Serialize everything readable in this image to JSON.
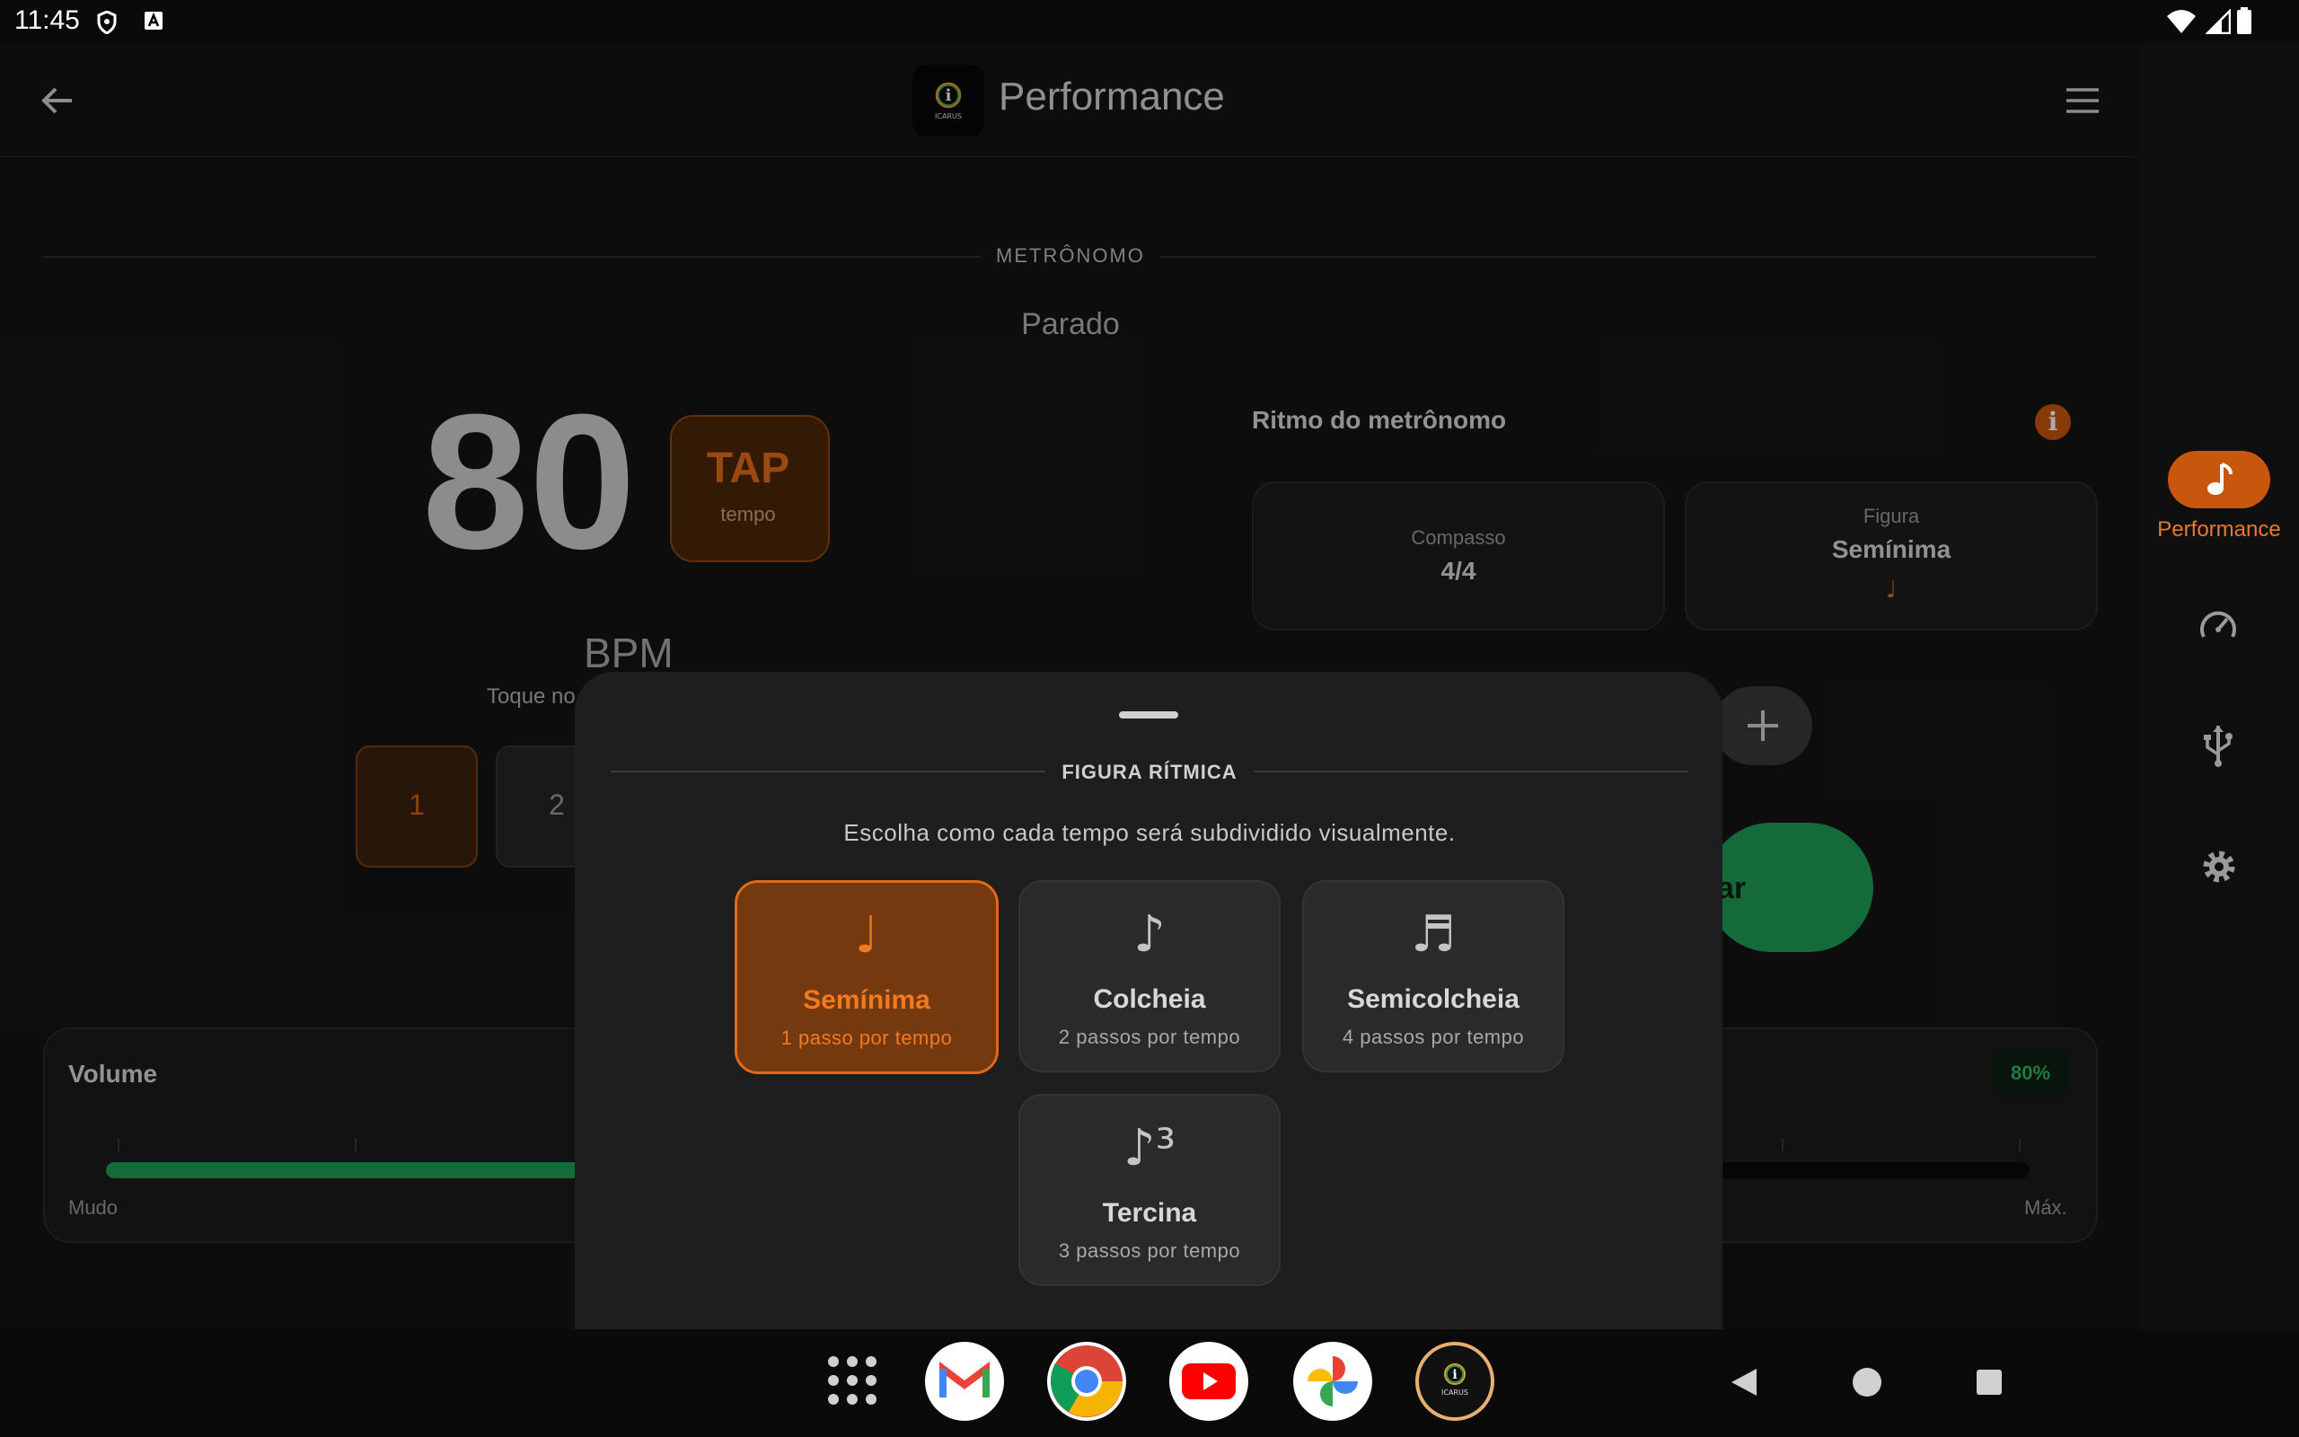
{
  "status_bar": {
    "time": "11:45"
  },
  "app_bar": {
    "title": "Performance"
  },
  "nav_rail": {
    "items": [
      {
        "label": "Performance",
        "icon": "music-note-icon",
        "active": true
      },
      {
        "icon": "speedometer-icon"
      },
      {
        "icon": "usb-icon"
      },
      {
        "icon": "settings-icon"
      }
    ]
  },
  "metronome": {
    "section_label": "METRÔNOMO",
    "status": "Parado",
    "bpm": "80",
    "bpm_unit": "BPM",
    "tap_label": "TAP",
    "tap_sub": "tempo",
    "hint_partial": "Toque no",
    "beats": [
      "1",
      "2"
    ]
  },
  "rhythm": {
    "title": "Ritmo do metrônomo",
    "compasso_label": "Compasso",
    "compasso_value": "4/4",
    "figura_label": "Figura",
    "figura_value": "Semínima",
    "figura_glyph": "♩",
    "start_partial": "ar"
  },
  "volume": {
    "title": "Volume",
    "percent_label": "80%",
    "level": 0.8,
    "min_label": "Mudo",
    "max_label": "Máx."
  },
  "sheet": {
    "title": "FIGURA RÍTMICA",
    "description": "Escolha como cada tempo será subdividido visualmente.",
    "options": [
      {
        "glyph": "♩",
        "name": "Semínima",
        "sub": "1 passo por tempo",
        "selected": true
      },
      {
        "glyph": "♪",
        "name": "Colcheia",
        "sub": "2 passos por tempo",
        "selected": false
      },
      {
        "glyph": "♬",
        "name": "Semicolcheia",
        "sub": "4 passos por tempo",
        "selected": false
      },
      {
        "glyph": "♪³",
        "name": "Tercina",
        "sub": "3 passos por tempo",
        "selected": false
      }
    ]
  },
  "taskbar": {
    "apps": [
      "app-drawer",
      "gmail",
      "chrome",
      "youtube",
      "photos",
      "icarus"
    ]
  },
  "colors": {
    "accent": "#e06a16",
    "green": "#1f9d55",
    "background": "#141414"
  }
}
